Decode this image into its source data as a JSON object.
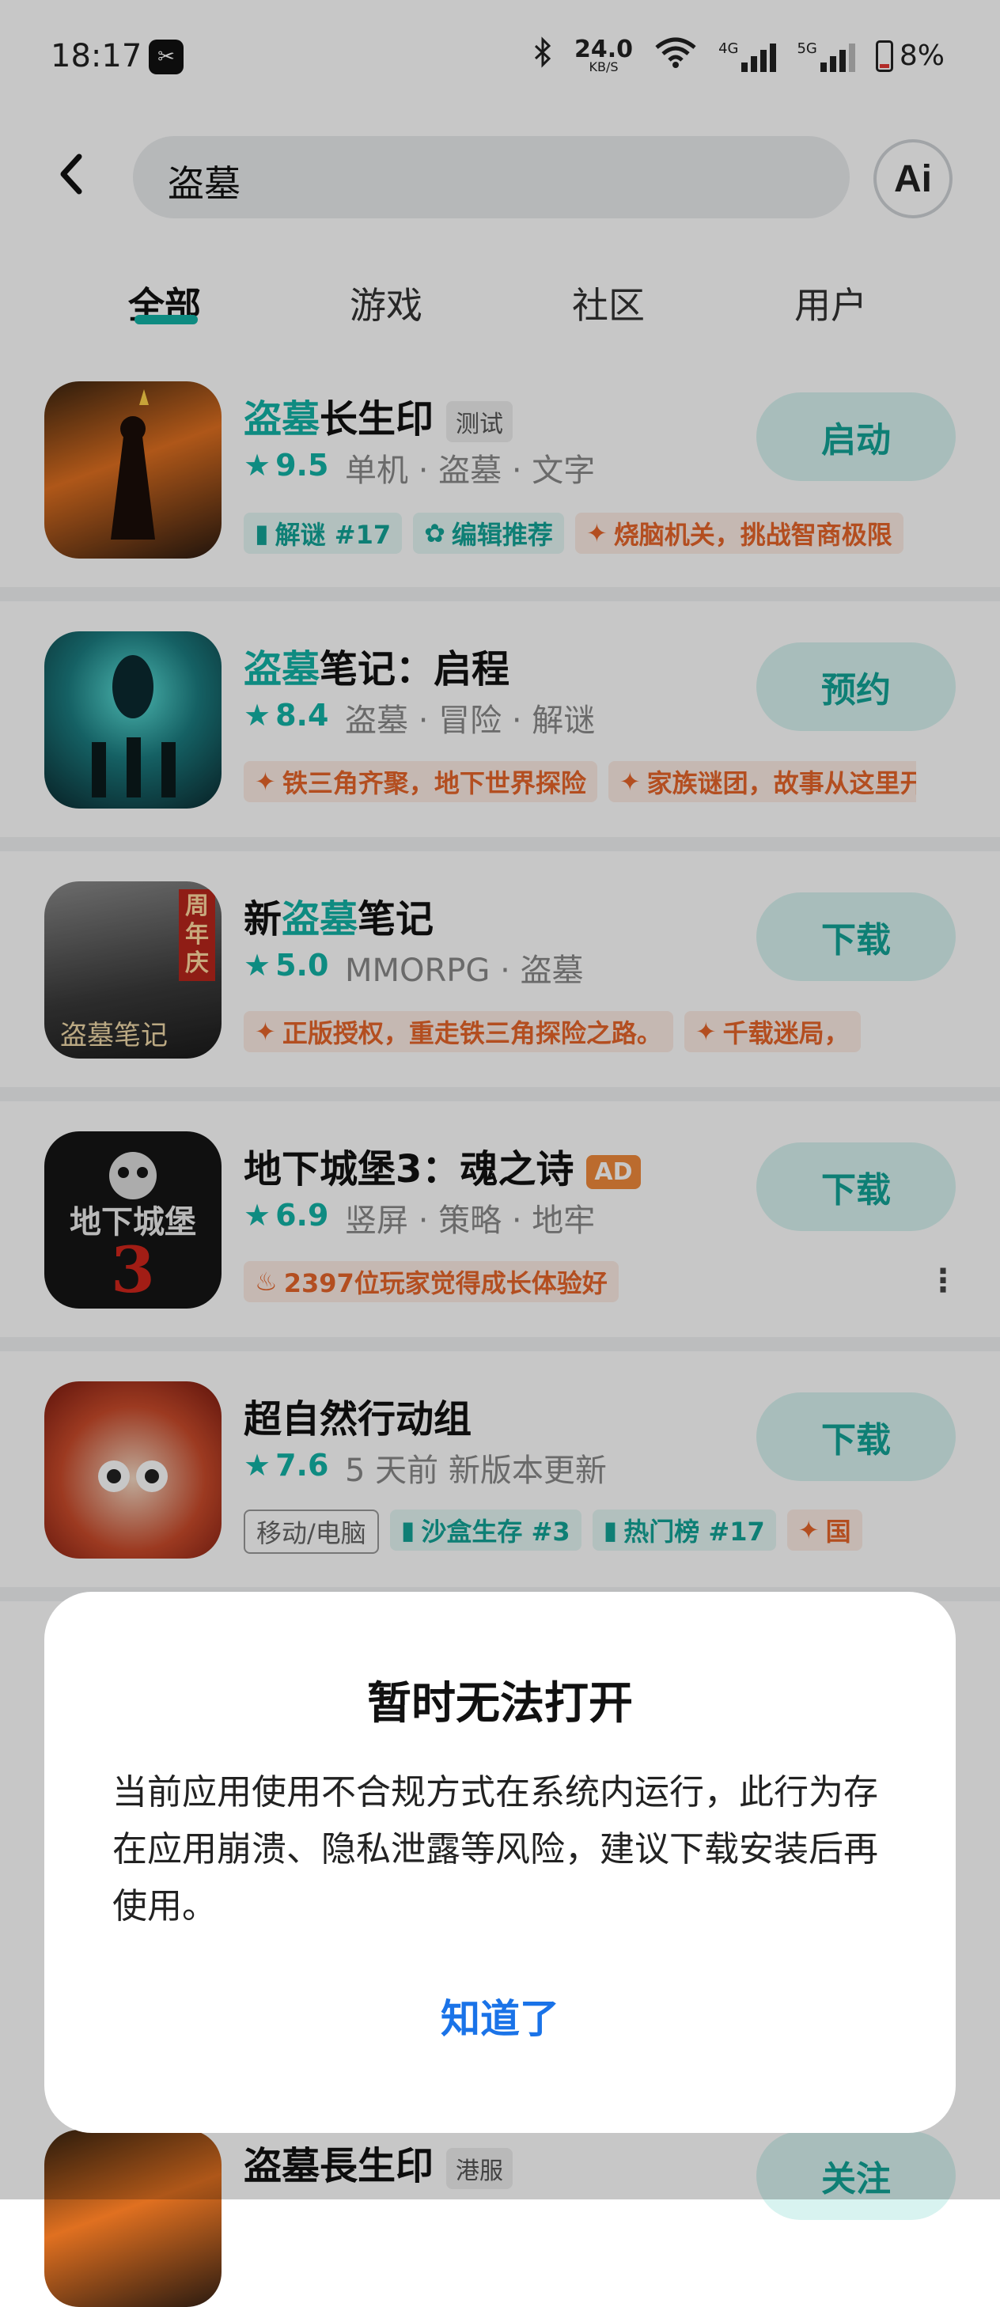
{
  "status_bar": {
    "time": "18:17",
    "app_badge": "✂",
    "net_speed_value": "24.0",
    "net_speed_unit": "KB/S",
    "network_4g": "4G",
    "network_5g": "5G",
    "battery": "8%"
  },
  "search": {
    "query": "盗墓",
    "ai_label": "Ai"
  },
  "tabs": [
    {
      "label": "全部",
      "active": true
    },
    {
      "label": "游戏",
      "active": false
    },
    {
      "label": "社区",
      "active": false
    },
    {
      "label": "用户",
      "active": false
    }
  ],
  "results": [
    {
      "title_hl": "盗墓",
      "title_rest": "长生印",
      "tag": "测试",
      "score": "9.5",
      "meta": "单机 · 盗墓 · 文字",
      "chips": [
        "解谜 #17",
        "编辑推荐",
        "烧脑机关，挑战智商极限"
      ],
      "action": "启动"
    },
    {
      "title_hl": "盗墓",
      "title_rest": "笔记：启程",
      "score": "8.4",
      "meta": "盗墓 · 冒险 · 解谜",
      "chips": [
        "铁三角齐聚，地下世界探险",
        "家族谜团，故事从这里开始"
      ],
      "action": "预约"
    },
    {
      "title_pre": "新",
      "title_hl": "盗墓",
      "title_rest": "笔记",
      "score": "5.0",
      "meta": "MMORPG · 盗墓",
      "chips": [
        "正版授权，重走铁三角探险之路。",
        "千载迷局，"
      ],
      "icon_badge": "周年庆",
      "icon_caption": "盗墓笔记",
      "action": "下载"
    },
    {
      "title_rest": "地下城堡3：魂之诗",
      "ad": "AD",
      "score": "6.9",
      "meta": "竖屏 · 策略 · 地牢",
      "chips": [
        "2397位玩家觉得成长体验好"
      ],
      "icon_caption": "地下城堡",
      "icon_number": "3",
      "action": "下载"
    },
    {
      "title_rest": "超自然行动组",
      "score": "7.6",
      "meta": "5 天前 新版本更新",
      "chips": [
        "移动/电脑",
        "沙盒生存 #3",
        "热门榜 #17",
        "国"
      ],
      "action": "下载"
    },
    {
      "title_rest": "盗墓長生印",
      "tag": "港服",
      "action": "关注"
    }
  ],
  "dialog": {
    "title": "暂时无法打开",
    "body": "当前应用使用不合规方式在系统内运行，此行为存在应用崩溃、隐私泄露等风险，建议下载安装后再使用。",
    "confirm": "知道了"
  },
  "colors": {
    "accent": "#13b3a6",
    "orange": "#e6642a",
    "link_blue": "#1a73e8"
  }
}
